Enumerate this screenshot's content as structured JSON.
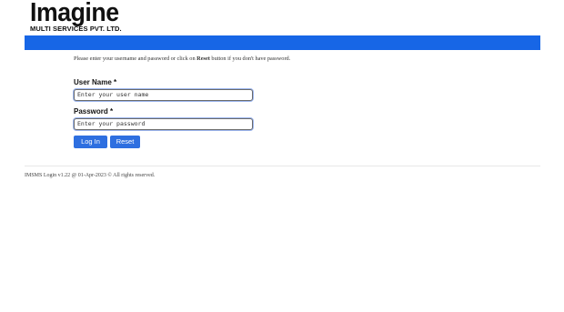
{
  "brand": {
    "name": "Imagine",
    "subtitle": "MULTI SERVICES PVT. LTD."
  },
  "instruction": {
    "before": "Please enter your username and password or click on ",
    "reset_word": "Reset",
    "after": " button if you don't have password."
  },
  "form": {
    "username_label": "User Name *",
    "username_placeholder": "Enter your user name",
    "password_label": "Password *",
    "password_placeholder": "Enter your password",
    "login_label": "Log In",
    "reset_label": "Reset"
  },
  "footer": {
    "text": "IMSMS Login v1.22 @ 01-Apr-2023 © All rights reserved."
  },
  "colors": {
    "header_bar": "#1766e6",
    "button": "#2e6fe0"
  }
}
